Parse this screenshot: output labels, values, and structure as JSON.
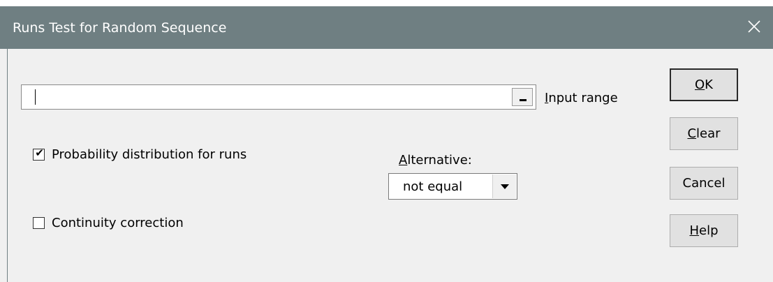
{
  "window": {
    "title": "Runs Test for Random Sequence"
  },
  "input_range": {
    "value": "",
    "label_mnemonic": "I",
    "label_rest": "nput range",
    "picker_glyph": "_"
  },
  "options": {
    "probability_label": "Probability distribution for runs",
    "probability_checked": true,
    "continuity_label": "Continuity correction",
    "continuity_checked": false,
    "check_glyph": "✔"
  },
  "alternative": {
    "label_mnemonic": "A",
    "label_rest": "lternative:",
    "selected": "not equal"
  },
  "buttons": {
    "ok_mnemonic": "O",
    "ok_rest": "K",
    "clear_mnemonic": "C",
    "clear_rest": "lear",
    "cancel": "Cancel",
    "help_mnemonic": "H",
    "help_rest": "elp"
  },
  "colors": {
    "titlebar": "#6f7f82",
    "dialog_bg": "#f0f0f0",
    "button_bg": "#e1e1e1"
  }
}
